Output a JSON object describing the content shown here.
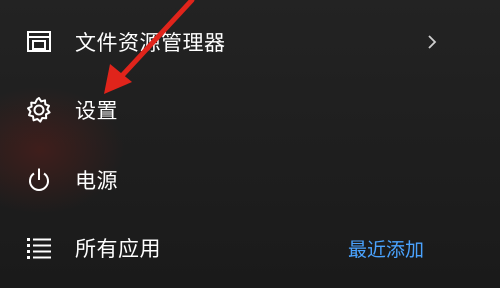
{
  "menu": {
    "items": [
      {
        "label": "文件资源管理器",
        "icon": "file-explorer-icon",
        "has_submenu": true
      },
      {
        "label": "设置",
        "icon": "gear-icon"
      },
      {
        "label": "电源",
        "icon": "power-icon"
      },
      {
        "label": "所有应用",
        "icon": "list-icon",
        "right_link": "最近添加"
      }
    ]
  },
  "colors": {
    "background": "#1c1c1c",
    "text": "#ffffff",
    "link": "#4aa3ff",
    "annotation_arrow": "#e0241b"
  }
}
